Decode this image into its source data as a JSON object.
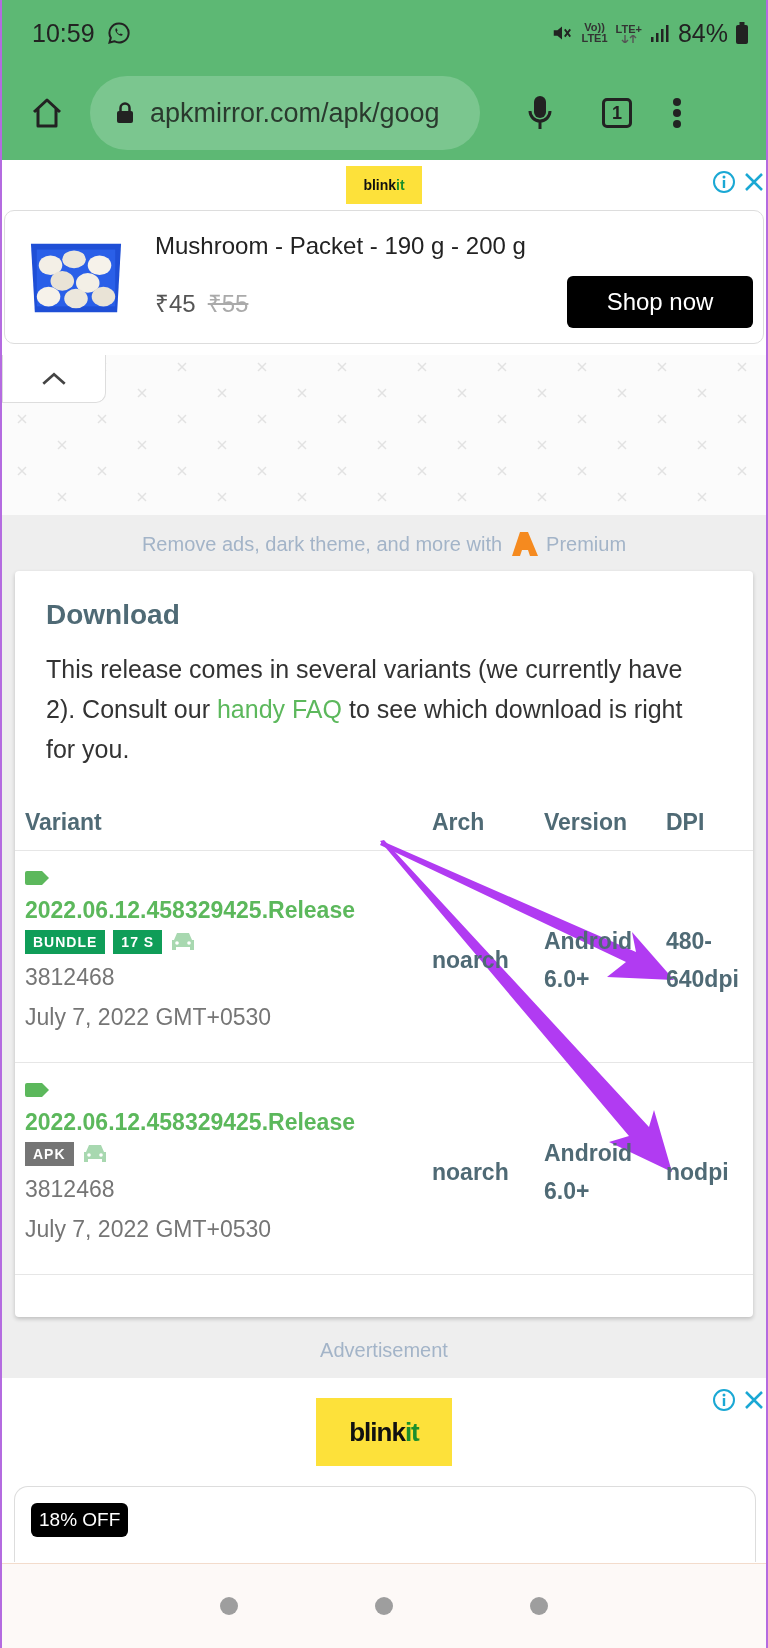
{
  "status_bar": {
    "time": "10:59",
    "volte": "Vo))",
    "lte1": "LTE1",
    "lte_plus": "LTE+",
    "battery": "84%"
  },
  "browser": {
    "url": "apkmirror.com/apk/goog",
    "tab_count": "1"
  },
  "top_ad": {
    "logo": {
      "main": "blink",
      "accent": "it"
    },
    "product": "Mushroom - Packet - 190 g - 200 g",
    "price": "₹45",
    "old_price": "₹55",
    "button": "Shop now"
  },
  "premium_banner": {
    "text": "Remove ads, dark theme, and more with",
    "link": "Premium"
  },
  "download": {
    "title": "Download",
    "intro_before": "This release comes in several variants (we currently have 2). Consult our",
    "faq_link": "handy FAQ",
    "intro_after": "to see which download is right for you.",
    "columns": [
      "Variant",
      "Arch",
      "Version",
      "DPI"
    ],
    "rows": [
      {
        "variant": "2022.06.12.458329425.Release",
        "badges": [
          {
            "label": "BUNDLE",
            "color": "#0f9d58"
          },
          {
            "label": "17 S",
            "color": "#0f9d58"
          }
        ],
        "size": "3812468",
        "date": "July 7, 2022 GMT+0530",
        "arch": "noarch",
        "version": "Android 6.0+",
        "dpi": "480-640dpi"
      },
      {
        "variant": "2022.06.12.458329425.Release",
        "badges": [
          {
            "label": "APK",
            "color": "#757575"
          }
        ],
        "size": "3812468",
        "date": "July 7, 2022 GMT+0530",
        "arch": "noarch",
        "version": "Android 6.0+",
        "dpi": "nodpi"
      }
    ]
  },
  "ad_label": "Advertisement",
  "bottom_ad": {
    "logo": {
      "main": "blink",
      "accent": "it"
    },
    "discount": "18% OFF"
  }
}
